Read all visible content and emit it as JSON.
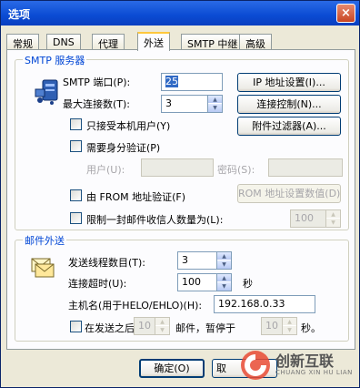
{
  "window": {
    "title": "选项",
    "close": "×"
  },
  "tabs": [
    "常规",
    "DNS",
    "代理",
    "外送",
    "SMTP 中继",
    "高级"
  ],
  "smtp": {
    "legend": "SMTP 服务器",
    "port_label": "SMTP 端口(P):",
    "port_value": "25",
    "maxconn_label": "最大连接数(T):",
    "maxconn_value": "3",
    "local_users_only": "只接受本机用户(Y)",
    "need_auth": "需要身分验证(P)",
    "user_label": "用户(U):",
    "user_value": "",
    "password_label": "密码(S):",
    "password_value": "",
    "from_verify": "由 FROM 地址验证(F)",
    "limit_recipients": "限制一封邮件收信人数量为(L):",
    "limit_value": "100",
    "ip_button": "IP 地址设置(I)...",
    "conn_button": "连接控制(N)...",
    "attach_button": "附件过滤器(A)...",
    "rom_button": "ROM 地址设置数值(D)"
  },
  "outgoing": {
    "legend": "邮件外送",
    "threads_label": "发送线程数目(T):",
    "threads_value": "3",
    "timeout_label": "连接超时(U):",
    "timeout_value": "100",
    "timeout_unit": "秒",
    "hostname_label": "主机名(用于HELO/EHLO)(H):",
    "hostname_value": "192.168.0.33",
    "pause_prefix": "在发送之后",
    "pause_count": "10",
    "pause_mid": "邮件，暂停于",
    "pause_seconds": "10",
    "pause_suffix": "秒。"
  },
  "footer": {
    "ok": "确定(O)",
    "cancel": "取"
  },
  "watermark": {
    "brand": "创新互联",
    "sub": "CHUANG XIN HU LIAN"
  }
}
